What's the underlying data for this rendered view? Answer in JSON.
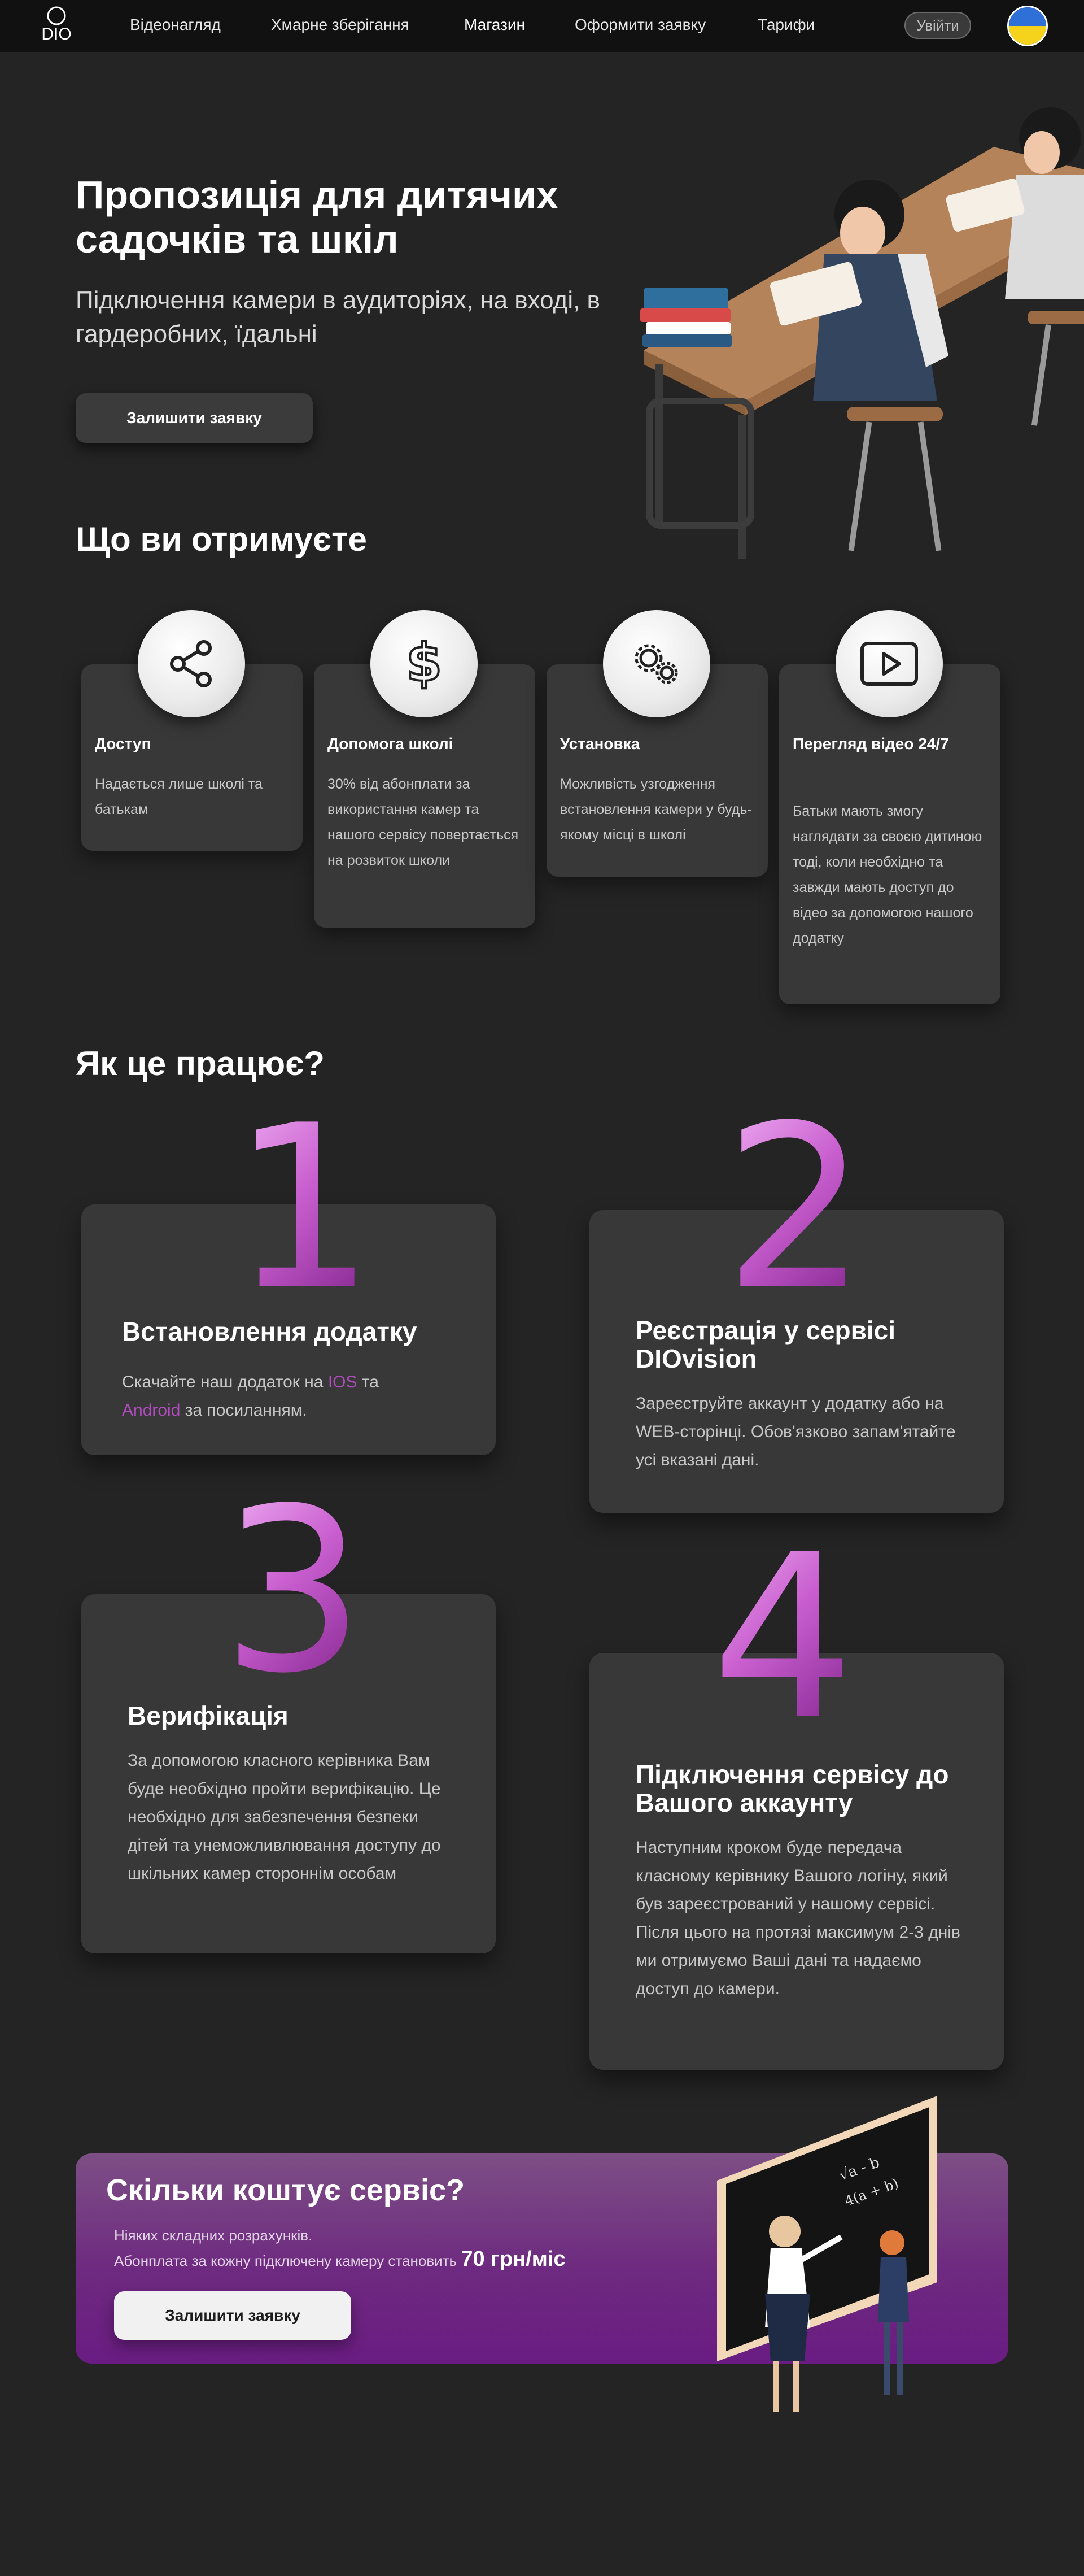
{
  "nav": {
    "logo_text": "DIO",
    "links": [
      "Відеонагляд",
      "Хмарне зберігання",
      "Магазин",
      "Оформити заявку",
      "Тарифи"
    ],
    "login_label": "Увійти",
    "language_icon": "ukraine-flag-icon"
  },
  "hero": {
    "title": "Пропозиція для дитячих садочків та шкіл",
    "subtitle": "Підключення камери в аудиторіях, на вході, в гардеробних, їдальні",
    "cta_label": "Залишити заявку"
  },
  "features": {
    "title": "Що ви отримуєте",
    "items": [
      {
        "icon": "share-icon",
        "title": "Доступ",
        "text": "Надається лише школі та батькам"
      },
      {
        "icon": "dollar-icon",
        "title": "Допомога школі",
        "text": "30% від абонплати за використання камер та нашого сервісу повертається на розвиток школи"
      },
      {
        "icon": "gears-icon",
        "title": "Установка",
        "text": "Можливість узгодження встановлення камери у будь-якому місці в школі"
      },
      {
        "icon": "play-video-icon",
        "title": "Перегляд відео 24/7",
        "text": "Батьки мають змогу наглядати за своєю дитиною тоді, коли необхідно та завжди мають доступ до відео за допомогою нашого додатку"
      }
    ]
  },
  "how": {
    "title": "Як це працює?",
    "steps": [
      {
        "number": "1",
        "title": "Встановлення додатку",
        "text_before": "Скачайте наш додаток на ",
        "link_ios": "IOS",
        "text_middle": "  та ",
        "link_android": "Android",
        "text_after": " за посиланням."
      },
      {
        "number": "2",
        "title": "Реєстрація у сервісі DIOvision",
        "text": "Зареєструйте аккаунт у додатку або на WEB-сторінці. Обов'язково запам'ятайте усі вказані дані."
      },
      {
        "number": "3",
        "title": "Верифікація",
        "text": "За допомогою класного керівника Вам буде необхідно пройти верифікацію. Це необхідно для забезпечення безпеки дітей та унеможливлювання доступу до шкільних камер стороннім особам"
      },
      {
        "number": "4",
        "title": "Підключення сервісу до Вашого аккаунту",
        "text": "Наступним кроком буде передача класному керівнику Вашого логіну, який був зареєстрований у нашому сервісі. Після цього на протязі максимум 2-3 днів ми отримуємо Ваші дані та надаємо доступ до камери."
      }
    ]
  },
  "price": {
    "title": "Скільки коштує сервіс?",
    "line1": "Ніяких складних розрахунків.",
    "line2": "Абонплата за кожну підключену камеру становить ",
    "value": "70 грн/міс",
    "cta_label": "Залишити заявку"
  },
  "colors": {
    "background": "#242424",
    "nav_background": "#111111",
    "card": "#383838",
    "accent_purple": "#b14cc0",
    "price_banner": "#6e2a80"
  }
}
